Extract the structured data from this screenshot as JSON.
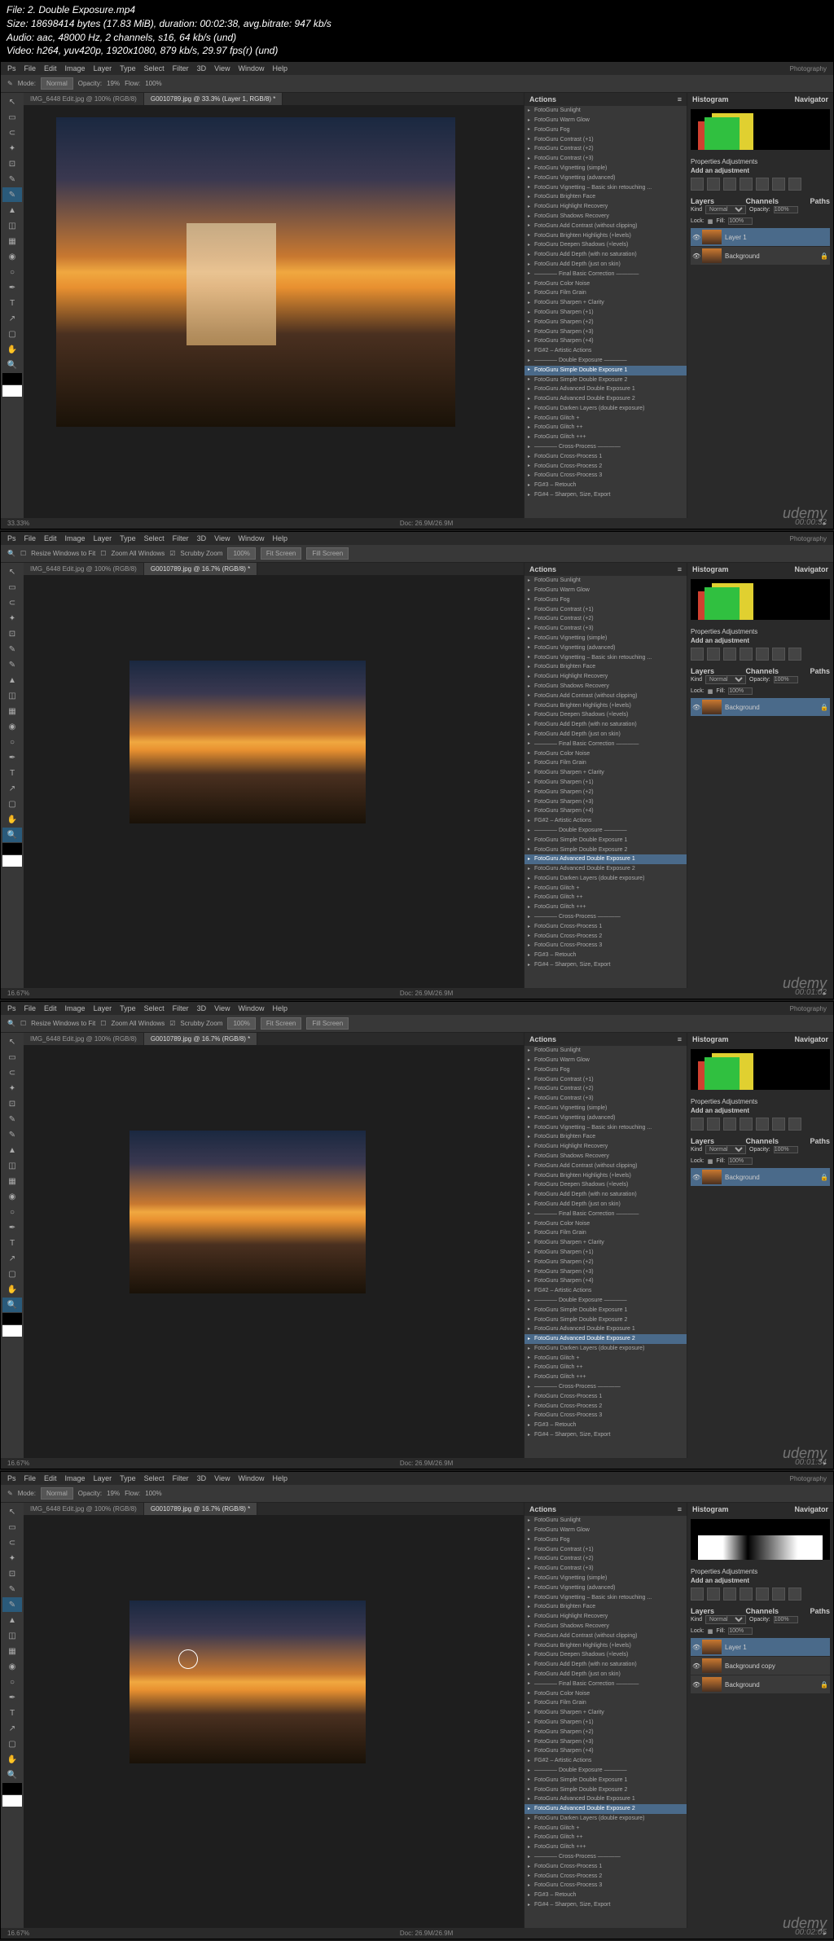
{
  "metadata": {
    "file": "File: 2. Double Exposure.mp4",
    "size": "Size: 18698414 bytes (17.83 MiB), duration: 00:02:38, avg.bitrate: 947 kb/s",
    "audio": "Audio: aac, 48000 Hz, 2 channels, s16, 64 kb/s (und)",
    "video": "Video: h264, yuv420p, 1920x1080, 879 kb/s, 29.97 fps(r) (und)"
  },
  "menu": [
    "Ps",
    "File",
    "Edit",
    "Image",
    "Layer",
    "Type",
    "Select",
    "Filter",
    "3D",
    "View",
    "Window",
    "Help"
  ],
  "workspace": "Photography",
  "toolbar_common": {
    "resize": "Resize Windows to Fit",
    "zoom_all": "Zoom All Windows",
    "scrubby": "Scrubby Zoom",
    "btn100": "100%",
    "fit": "Fit Screen",
    "fill": "Fill Screen"
  },
  "toolbar_brush": {
    "mode": "Mode:",
    "normal": "Normal",
    "opacity": "Opacity:",
    "opacity_val": "19%",
    "flow": "Flow:",
    "flow_val": "100%"
  },
  "tabs": {
    "tab1": "IMG_6448 Edit.jpg @ 100% (RGB/8)",
    "tab2_f1": "G0010789.jpg @ 33.3% (Layer 1, RGB/8) *",
    "tab2_f2": "G0010789.jpg @ 16.7% (RGB/8) *",
    "tab2_f3": "G0010789.jpg @ 16.7% (RGB/8) *",
    "tab2_f4": "G0010789.jpg @ 16.7% (RGB/8) *"
  },
  "actions": {
    "header": "Actions",
    "items": [
      "FotoGuru Sunlight",
      "FotoGuru Warm Glow",
      "FotoGuru Fog",
      "FotoGuru Contrast (+1)",
      "FotoGuru Contrast (+2)",
      "FotoGuru Contrast (+3)",
      "FotoGuru Vignetting (simple)",
      "FotoGuru Vignetting (advanced)",
      "FotoGuru Vignetting – Basic skin retouching ...",
      "FotoGuru Brighten Face",
      "FotoGuru Highlight Recovery",
      "FotoGuru Shadows Recovery",
      "FotoGuru Add Contrast (without clipping)",
      "FotoGuru Brighten Highlights (+levels)",
      "FotoGuru Deepen Shadows (+levels)",
      "FotoGuru Add Depth (with no saturation)",
      "FotoGuru Add Depth (just on skin)",
      "———— Final Basic Correction ————",
      "FotoGuru Color Noise",
      "FotoGuru Film Grain",
      "FotoGuru Sharpen + Clarity",
      "FotoGuru Sharpen (+1)",
      "FotoGuru Sharpen (+2)",
      "FotoGuru Sharpen (+3)",
      "FotoGuru Sharpen (+4)",
      "FG#2 – Artistic Actions",
      "———— Double Exposure ————",
      "FotoGuru Simple Double Exposure 1",
      "FotoGuru Simple Double Exposure 2",
      "FotoGuru Advanced Double Exposure 1",
      "FotoGuru Advanced Double Exposure 2",
      "FotoGuru Darken Layers (double exposure)",
      "FotoGuru Glitch +",
      "FotoGuru Glitch ++",
      "FotoGuru Glitch +++",
      "———— Cross-Process ————",
      "FotoGuru Cross-Process 1",
      "FotoGuru Cross-Process 2",
      "FotoGuru Cross-Process 3",
      "FG#3 – Retouch",
      "FG#4 – Sharpen, Size, Export"
    ],
    "sel_f1": 27,
    "sel_f2": 29,
    "sel_f3": 30,
    "sel_f4": 30
  },
  "panels": {
    "histogram": "Histogram",
    "navigator": "Navigator",
    "adjustments": "Adjustments",
    "add_adjustment": "Add an adjustment",
    "layers": "Layers",
    "channels": "Channels",
    "paths": "Paths",
    "normal": "Normal",
    "opacity": "Opacity:",
    "opacity_val": "100%",
    "lock": "Lock:",
    "fill": "Fill:",
    "fill_val": "100%",
    "kind": "Kind"
  },
  "layers_f1": [
    {
      "name": "Layer 1"
    },
    {
      "name": "Background"
    }
  ],
  "layers_f2": [
    {
      "name": "Background"
    }
  ],
  "layers_f3": [
    {
      "name": "Background"
    }
  ],
  "layers_f4": [
    {
      "name": "Layer 1"
    },
    {
      "name": "Background copy"
    },
    {
      "name": "Background"
    }
  ],
  "status": {
    "zoom_f1": "33.33%",
    "zoom_f2": "16.67%",
    "zoom_f3": "16.67%",
    "zoom_f4": "16.67%",
    "doc": "Doc: 26.9M/26.9M"
  },
  "watermark": "udemy",
  "timestamps": [
    "00:00:32",
    "00:01:02",
    "00:01:34",
    "00:02:05"
  ]
}
